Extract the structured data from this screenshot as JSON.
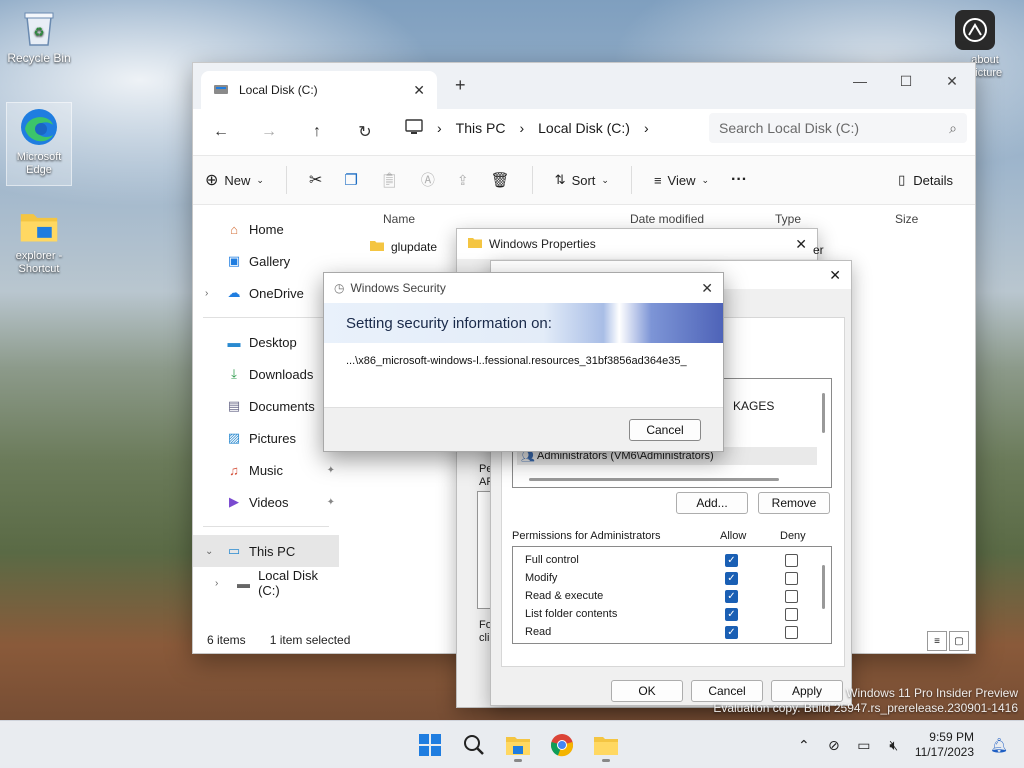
{
  "desktop": {
    "icons": [
      {
        "label": "Recycle Bin"
      },
      {
        "label": "Microsoft Edge"
      },
      {
        "label": "explorer - Shortcut"
      },
      {
        "label": "about Picture"
      }
    ]
  },
  "explorer": {
    "tab_title": "Local Disk (C:)",
    "breadcrumb": [
      "This PC",
      "Local Disk (C:)"
    ],
    "search_placeholder": "Search Local Disk (C:)",
    "commands": {
      "new": "New",
      "sort": "Sort",
      "view": "View",
      "details": "Details"
    },
    "sidebar": {
      "home": "Home",
      "gallery": "Gallery",
      "onedrive": "OneDrive",
      "desktop": "Desktop",
      "downloads": "Downloads",
      "documents": "Documents",
      "pictures": "Pictures",
      "music": "Music",
      "videos": "Videos",
      "this_pc": "This PC",
      "local_disk": "Local Disk (C:)"
    },
    "columns": {
      "name": "Name",
      "date": "Date modified",
      "type": "Type",
      "size": "Size"
    },
    "files": [
      {
        "name": "glupdate"
      }
    ],
    "status": {
      "count": "6 items",
      "selected": "1 item selected"
    }
  },
  "props_window": {
    "title": "Windows Properties",
    "partial_text_1": "Pe",
    "partial_text_2": "AF",
    "partial_text_3": "Fo",
    "partial_text_4": "cli",
    "partial_type": "er"
  },
  "perm_window": {
    "groups": {
      "packages": "KAGES",
      "admin": "Administrators (VM6\\Administrators)"
    },
    "add_label": "Add...",
    "remove_label": "Remove",
    "perm_title": "Permissions for Administrators",
    "allow_label": "Allow",
    "deny_label": "Deny",
    "permissions": [
      {
        "name": "Full control",
        "allow": true,
        "deny": false
      },
      {
        "name": "Modify",
        "allow": true,
        "deny": false
      },
      {
        "name": "Read & execute",
        "allow": true,
        "deny": false
      },
      {
        "name": "List folder contents",
        "allow": true,
        "deny": false
      },
      {
        "name": "Read",
        "allow": true,
        "deny": false
      }
    ],
    "ok_label": "OK",
    "cancel_label": "Cancel",
    "apply_label": "Apply"
  },
  "security_dialog": {
    "title": "Windows Security",
    "heading": "Setting security information on:",
    "path": "...\\x86_microsoft-windows-l..fessional.resources_31bf3856ad364e35_",
    "cancel_label": "Cancel"
  },
  "watermark": {
    "line1": "Windows 11 Pro Insider Preview",
    "line2": "Evaluation copy. Build 25947.rs_prerelease.230901-1416"
  },
  "taskbar": {
    "time": "9:59 PM",
    "date": "11/17/2023"
  },
  "colors": {
    "accent": "#1a5fb4",
    "folder": "#f4c542"
  }
}
